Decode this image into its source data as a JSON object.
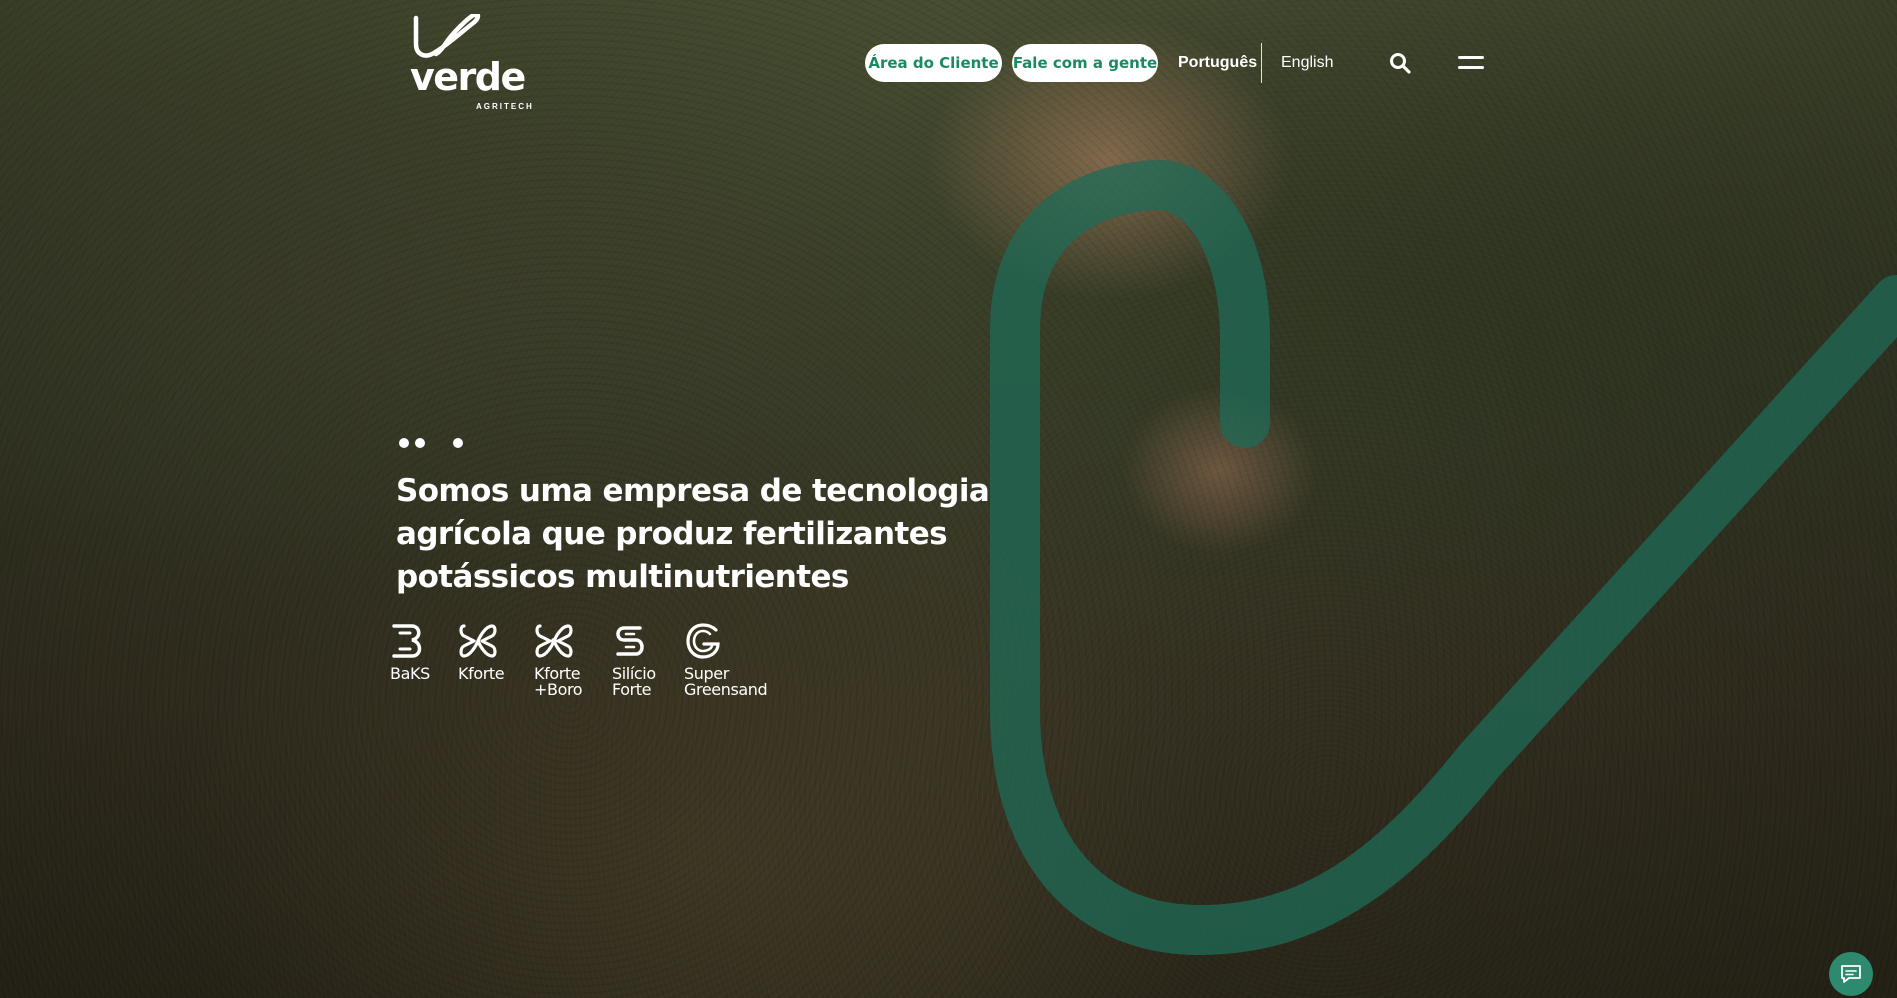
{
  "brand": {
    "name": "verde",
    "tagline": "AGRITECH"
  },
  "header": {
    "client_area_label": "Área do Cliente",
    "contact_label": "Fale com a gente",
    "languages": [
      "Português",
      "English"
    ],
    "active_language": "Português",
    "icons": [
      "search-icon",
      "hamburger-menu-icon"
    ]
  },
  "hero": {
    "slide_indicators": 3,
    "headline": "Somos uma empresa de tecnologia agrícola que produz fertilizantes potássicos multinutrientes",
    "products": [
      {
        "label": "BaKS",
        "icon": "baks-icon"
      },
      {
        "label": "Kforte",
        "icon": "kforte-icon"
      },
      {
        "label": "Kforte\n+Boro",
        "icon": "kforte-boro-icon"
      },
      {
        "label": "Silício\nForte",
        "icon": "silicio-forte-icon"
      },
      {
        "label": "Super\nGreensand",
        "icon": "super-greensand-icon"
      }
    ]
  },
  "chat": {
    "icon": "chat-bubble-icon"
  },
  "colors": {
    "accent_green": "#1b8a63",
    "decor_green": "#1f6b57",
    "chat_button": "#2d8a6f",
    "text": "#ffffff"
  }
}
